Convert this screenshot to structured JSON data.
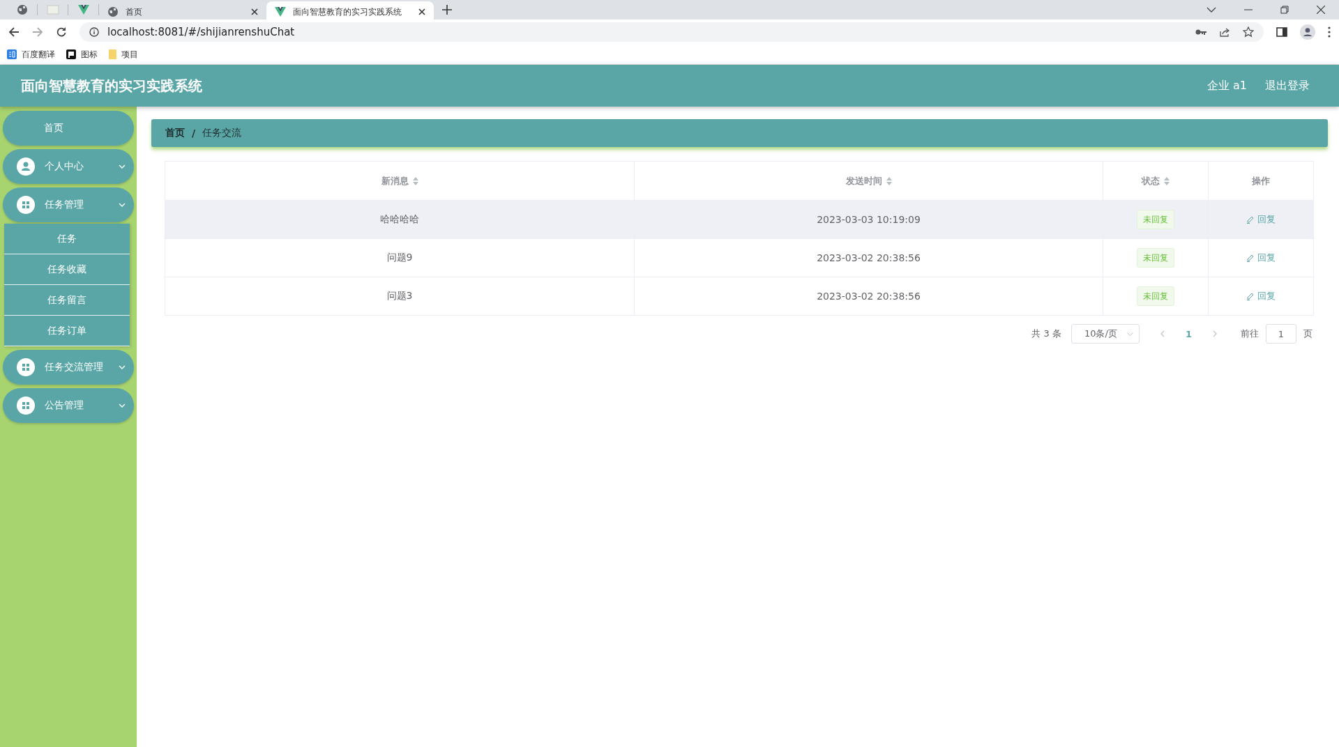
{
  "browser": {
    "tabs": [
      {
        "kind": "pinned",
        "selected": false
      },
      {
        "kind": "pinned",
        "selected": false
      },
      {
        "kind": "pinned",
        "selected": false
      },
      {
        "kind": "tab",
        "title": "首页",
        "selected": false
      },
      {
        "kind": "tab",
        "title": "面向智慧教育的实习实践系统",
        "selected": true
      }
    ],
    "url": "localhost:8081/#/shijianrenshuChat",
    "bookmarks": [
      "百度翻译",
      "图标",
      "项目"
    ]
  },
  "header": {
    "title": "面向智慧教育的实习实践系统",
    "user": "企业 a1",
    "logout": "退出登录"
  },
  "sidebar": {
    "items": [
      {
        "label": "首页",
        "kind": "link"
      },
      {
        "label": "个人中心",
        "kind": "account"
      },
      {
        "label": "任务管理",
        "kind": "group",
        "children": [
          {
            "label": "任务"
          },
          {
            "label": "任务收藏"
          },
          {
            "label": "任务留言"
          },
          {
            "label": "任务订单"
          }
        ]
      },
      {
        "label": "任务交流管理",
        "kind": "group"
      },
      {
        "label": "公告管理",
        "kind": "group"
      }
    ]
  },
  "breadcrumb": {
    "items": [
      "首页",
      "任务交流"
    ],
    "separator": "/"
  },
  "table": {
    "columns": [
      {
        "label": "新消息",
        "sortable": true
      },
      {
        "label": "发送时间",
        "sortable": true
      },
      {
        "label": "状态",
        "sortable": true
      },
      {
        "label": "操作",
        "sortable": false
      }
    ],
    "rows": [
      {
        "message": "哈哈哈哈",
        "time": "2023-03-03 10:19:09",
        "status": "未回复",
        "action": "回复",
        "highlighted": true
      },
      {
        "message": "问题9",
        "time": "2023-03-02 20:38:56",
        "status": "未回复",
        "action": "回复",
        "highlighted": false
      },
      {
        "message": "问题3",
        "time": "2023-03-02 20:38:56",
        "status": "未回复",
        "action": "回复",
        "highlighted": false
      }
    ]
  },
  "pagination": {
    "total": "共 3 条",
    "page_size": "10条/页",
    "pages": [
      {
        "label": "1",
        "selected": true
      }
    ],
    "goto_label": "前往",
    "goto_value": "1",
    "goto_suffix": "页"
  }
}
